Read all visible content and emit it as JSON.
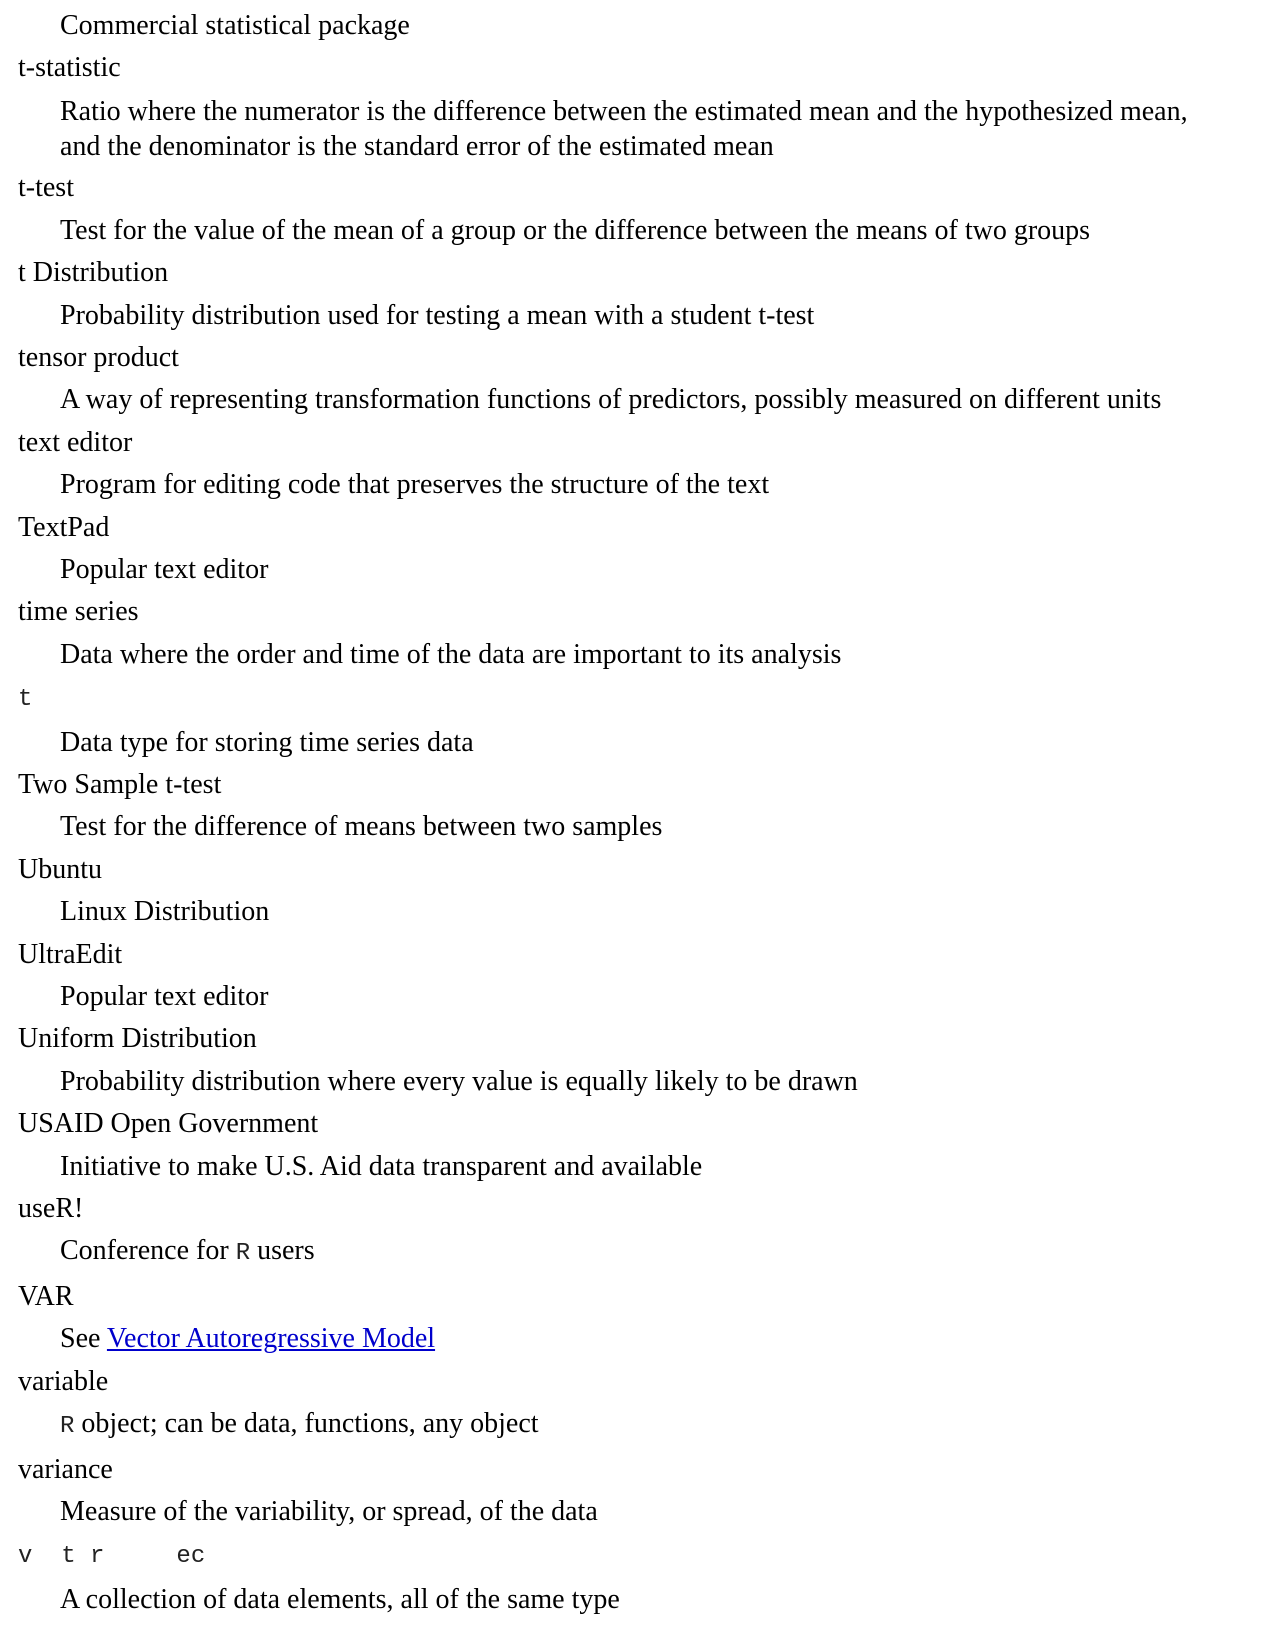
{
  "first_definition": "Commercial statistical package",
  "entries": [
    {
      "term": "t-statistic",
      "definition": "Ratio where the numerator is the difference between the estimated mean and the hypothesized mean, and the denominator is the standard error of the estimated mean"
    },
    {
      "term": "t-test",
      "definition": "Test for the value of the mean of a group or the difference between the means of two groups"
    },
    {
      "term": "t Distribution",
      "definition": "Probability distribution used for testing a mean with a student t-test"
    },
    {
      "term": "tensor product",
      "definition": "A way of representing transformation functions of predictors, possibly measured on different units"
    },
    {
      "term": "text editor",
      "definition": "Program for editing code that preserves the structure of the text"
    },
    {
      "term": "TextPad",
      "definition": "Popular text editor"
    },
    {
      "term": "time series",
      "definition": "Data where the order and time of the data are important to its analysis"
    },
    {
      "term": "t",
      "term_mono": true,
      "definition": "Data type for storing time series data"
    },
    {
      "term": "Two Sample t-test",
      "definition": "Test for the difference of means between two samples"
    },
    {
      "term": "Ubuntu",
      "definition": "Linux Distribution"
    },
    {
      "term": "UltraEdit",
      "definition": "Popular text editor"
    },
    {
      "term": "Uniform Distribution",
      "definition": "Probability distribution where every value is equally likely to be drawn"
    },
    {
      "term": "USAID Open Government",
      "definition": "Initiative to make U.S. Aid data transparent and available"
    },
    {
      "term": "useR!",
      "definition_parts": [
        "Conference for ",
        "R",
        " users"
      ]
    },
    {
      "term": "VAR",
      "definition_parts": [
        "See ",
        "Vector Autoregressive Model"
      ],
      "link": true
    },
    {
      "term": "variable",
      "definition_parts": [
        "",
        "R",
        " object; can be data, functions, any object"
      ]
    },
    {
      "term": "variance",
      "definition": "Measure of the variability, or spread, of the data"
    },
    {
      "term": "v  t r     ec",
      "term_mono": true,
      "definition": "A collection of data elements, all of the same type"
    }
  ]
}
